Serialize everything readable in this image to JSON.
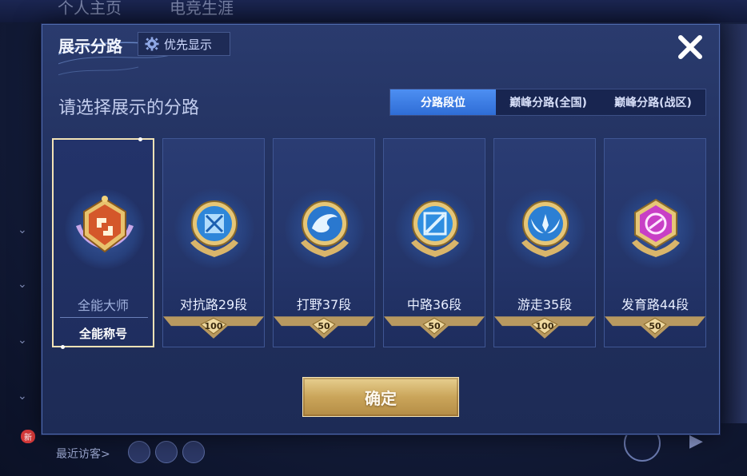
{
  "background": {
    "tabs": [
      "个人主页",
      "电竞生涯"
    ],
    "recent_visitors": "最近访客>",
    "new_badge": "新"
  },
  "dialog": {
    "title": "展示分路",
    "priority_button": "优先显示",
    "prompt": "请选择展示的分路",
    "tabs": [
      {
        "label": "分路段位",
        "active": true
      },
      {
        "label": "巅峰分路(全国)",
        "active": false
      },
      {
        "label": "巅峰分路(战区)",
        "active": false
      }
    ],
    "cards": [
      {
        "name": "全能大师",
        "subtitle": "全能称号",
        "selected": true,
        "icon": "all-round-master-medal-icon",
        "color": "#d4572a"
      },
      {
        "name": "对抗路29段",
        "badge": "100",
        "selected": false,
        "icon": "clash-lane-medal-icon",
        "color": "#2e86d9"
      },
      {
        "name": "打野37段",
        "badge": "50",
        "selected": false,
        "icon": "jungle-medal-icon",
        "color": "#2a78cf"
      },
      {
        "name": "中路36段",
        "badge": "50",
        "selected": false,
        "icon": "mid-lane-medal-icon",
        "color": "#2f8ee0"
      },
      {
        "name": "游走35段",
        "badge": "100",
        "selected": false,
        "icon": "roam-medal-icon",
        "color": "#2b7fd4"
      },
      {
        "name": "发育路44段",
        "badge": "50",
        "selected": false,
        "icon": "farm-lane-medal-icon",
        "color": "#c83fc6"
      }
    ],
    "confirm_button": "确定"
  },
  "colors": {
    "accent_tab": "#3b7de0",
    "gold": "#d9b56a",
    "dialog_bg": "#22315f"
  }
}
